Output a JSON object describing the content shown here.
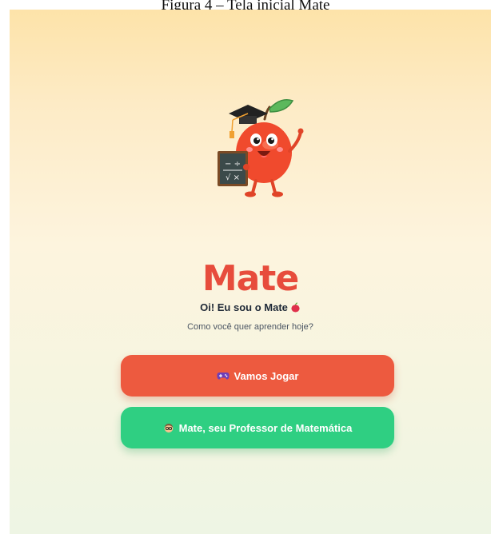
{
  "caption": "Figura 4 – Tela inicial Mate",
  "app": {
    "brand": "Mate",
    "greeting": "Oi! Eu sou o Mate",
    "subtitle": "Como você quer aprender hoje?"
  },
  "mascot": {
    "icon": "apple-mascot-icon",
    "chalkboard": {
      "line1": "− ÷",
      "line2": "√ ×"
    }
  },
  "buttons": {
    "play": {
      "label": "Vamos Jogar",
      "icon": "gamepad-icon",
      "color": "#ed5a3f"
    },
    "teacher": {
      "label": "Mate, seu Professor de Matemática",
      "icon": "teacher-icon",
      "color": "#2fcf82"
    }
  },
  "colors": {
    "brand": "#e74c3c",
    "background_top": "#fde3a9",
    "background_bottom": "#eef5e4"
  }
}
